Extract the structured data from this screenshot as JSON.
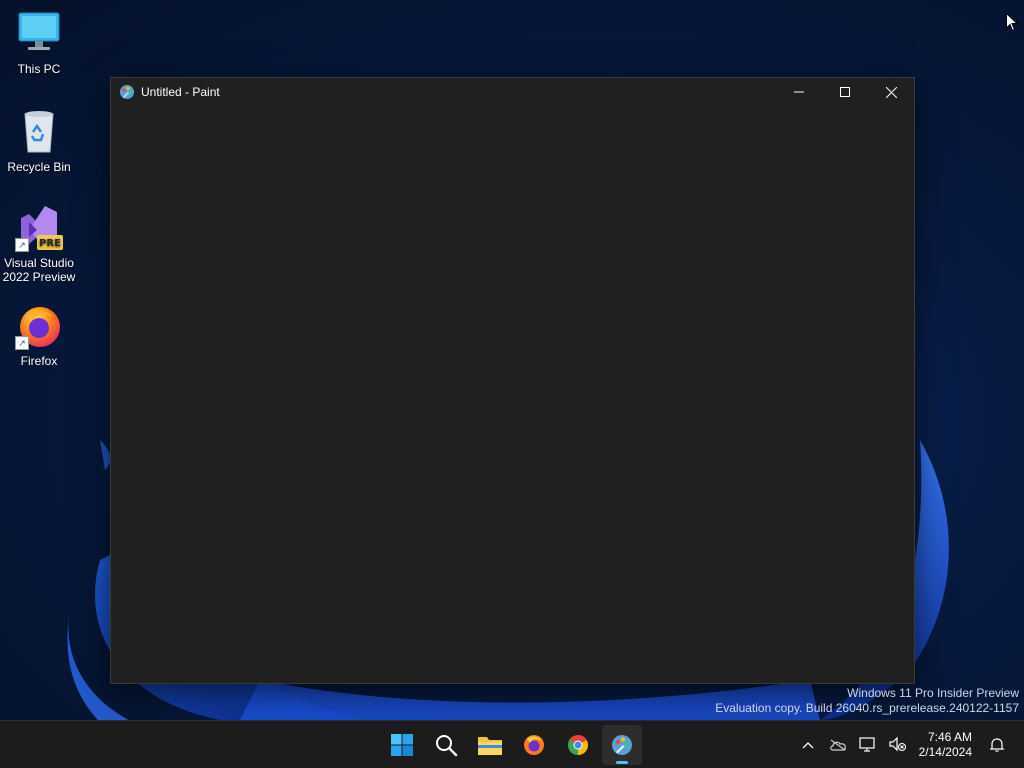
{
  "desktop": {
    "icons": [
      {
        "label": "This PC"
      },
      {
        "label": "Recycle Bin"
      },
      {
        "label": "Visual Studio 2022 Preview",
        "badge": "PRE"
      },
      {
        "label": "Firefox"
      }
    ]
  },
  "window": {
    "title": "Untitled - Paint"
  },
  "watermark": {
    "line1": "Windows 11 Pro Insider Preview",
    "line2": "Evaluation copy. Build 26040.rs_prerelease.240122-1157"
  },
  "taskbar": {
    "apps": [
      "start-icon",
      "search-icon",
      "file-explorer-icon",
      "firefox-icon",
      "chrome-icon",
      "paint-icon"
    ],
    "active_app": "paint-icon",
    "tray_icons": [
      "chevron-up-icon",
      "onedrive-icon",
      "network-icon",
      "volume-muted-icon"
    ],
    "time": "7:46 AM",
    "date": "2/14/2024"
  },
  "colors": {
    "window_bg": "#202020",
    "taskbar_bg": "#1c1c1c",
    "accent": "#4cc2ff"
  }
}
